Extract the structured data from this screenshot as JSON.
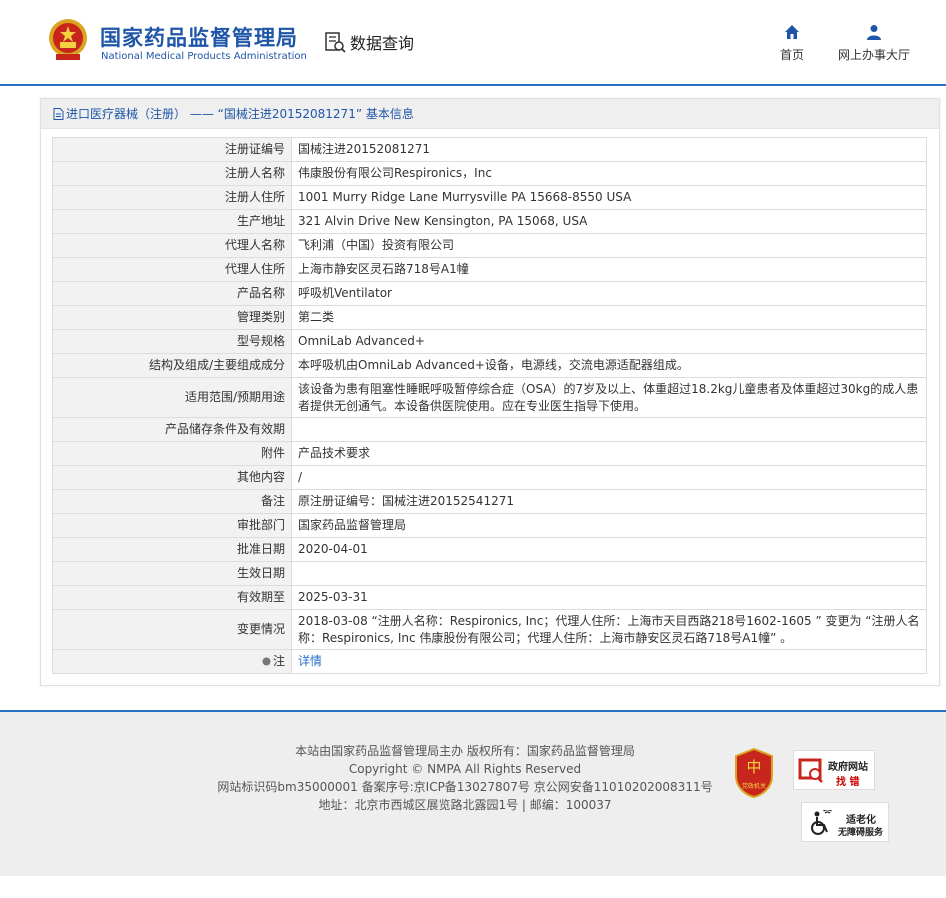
{
  "header": {
    "brand_cn": "国家药品监督管理局",
    "brand_en": "National Medical Products Administration",
    "data_query": "数据查询",
    "nav": [
      {
        "label": "首页",
        "icon": "home-icon"
      },
      {
        "label": "网上办事大厅",
        "icon": "user-icon"
      }
    ]
  },
  "panel": {
    "title": "进口医疗器械（注册） —— “国械注进20152081271” 基本信息",
    "rows": [
      {
        "label": "注册证编号",
        "value": "国械注进20152081271"
      },
      {
        "label": "注册人名称",
        "value": "伟康股份有限公司Respironics，Inc"
      },
      {
        "label": "注册人住所",
        "value": "1001 Murry Ridge Lane Murrysville PA 15668-8550 USA"
      },
      {
        "label": "生产地址",
        "value": "321 Alvin Drive New Kensington, PA 15068, USA"
      },
      {
        "label": "代理人名称",
        "value": "飞利浦（中国）投资有限公司"
      },
      {
        "label": "代理人住所",
        "value": "上海市静安区灵石路718号A1幢"
      },
      {
        "label": "产品名称",
        "value": "呼吸机Ventilator"
      },
      {
        "label": "管理类别",
        "value": "第二类"
      },
      {
        "label": "型号规格",
        "value": "OmniLab Advanced+"
      },
      {
        "label": "结构及组成/主要组成成分",
        "value": "本呼吸机由OmniLab Advanced+设备，电源线，交流电源适配器组成。"
      },
      {
        "label": "适用范围/预期用途",
        "value": "该设备为患有阻塞性睡眠呼吸暂停综合症（OSA）的7岁及以上、体重超过18.2kg儿童患者及体重超过30kg的成人患者提供无创通气。本设备供医院使用。应在专业医生指导下使用。"
      },
      {
        "label": "产品储存条件及有效期",
        "value": ""
      },
      {
        "label": "附件",
        "value": "产品技术要求"
      },
      {
        "label": "其他内容",
        "value": "/"
      },
      {
        "label": "备注",
        "value": "原注册证编号：国械注进20152541271"
      },
      {
        "label": "审批部门",
        "value": "国家药品监督管理局"
      },
      {
        "label": "批准日期",
        "value": "2020-04-01"
      },
      {
        "label": "生效日期",
        "value": ""
      },
      {
        "label": "有效期至",
        "value": "2025-03-31"
      },
      {
        "label": "变更情况",
        "value": "2018-03-08 “注册人名称：Respironics, Inc；代理人住所：上海市天目西路218号1602-1605 ” 变更为 “注册人名称：Respironics, Inc 伟康股份有限公司；代理人住所：上海市静安区灵石路718号A1幢” 。"
      }
    ],
    "note_label": "注",
    "note_link": "详情"
  },
  "footer": {
    "line1": "本站由国家药品监督管理局主办 版权所有：国家药品监督管理局",
    "line2": "Copyright © NMPA All Rights Reserved",
    "line3": "网站标识码bm35000001    备案序号:京ICP备13027807号    京公网安备11010202008311号",
    "line4": "地址：北京市西城区展览路北露园1号 | 邮编：100037",
    "badge_red": "党政机关",
    "gov_badge_title": "政府网站",
    "gov_badge_sub": "找 错",
    "elderly_badge_title": "适老化",
    "elderly_badge_sub": "无障碍服务"
  },
  "colors": {
    "brand_blue": "#1f56a8",
    "link_blue": "#2a6fc6",
    "label_bg": "#f2f2f2"
  }
}
